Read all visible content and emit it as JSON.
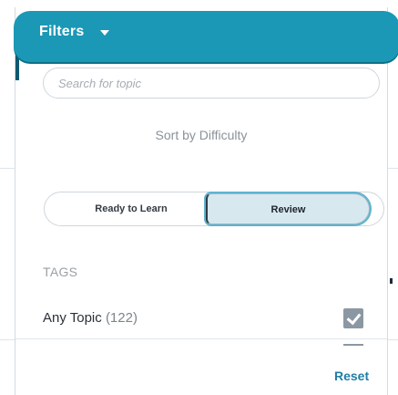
{
  "filters": {
    "title": "Filters",
    "toggle_icon": "caret-down-icon"
  },
  "search": {
    "placeholder": "Search for topic",
    "value": ""
  },
  "sort": {
    "label": "Sort by Difficulty"
  },
  "mode_toggle": {
    "options": [
      {
        "label": "Ready to Learn",
        "selected": false
      },
      {
        "label": "Review",
        "selected": true
      }
    ]
  },
  "tags": {
    "heading": "TAGS",
    "items": [
      {
        "name": "Any Topic",
        "count": "(122)",
        "checked": true
      }
    ]
  },
  "footer": {
    "reset_label": "Reset"
  },
  "colors": {
    "header_bg": "#1b98b6",
    "accent": "#1f7fa3",
    "checkbox": "#8b98a3",
    "selected_option_bg": "#d7e8ef"
  }
}
